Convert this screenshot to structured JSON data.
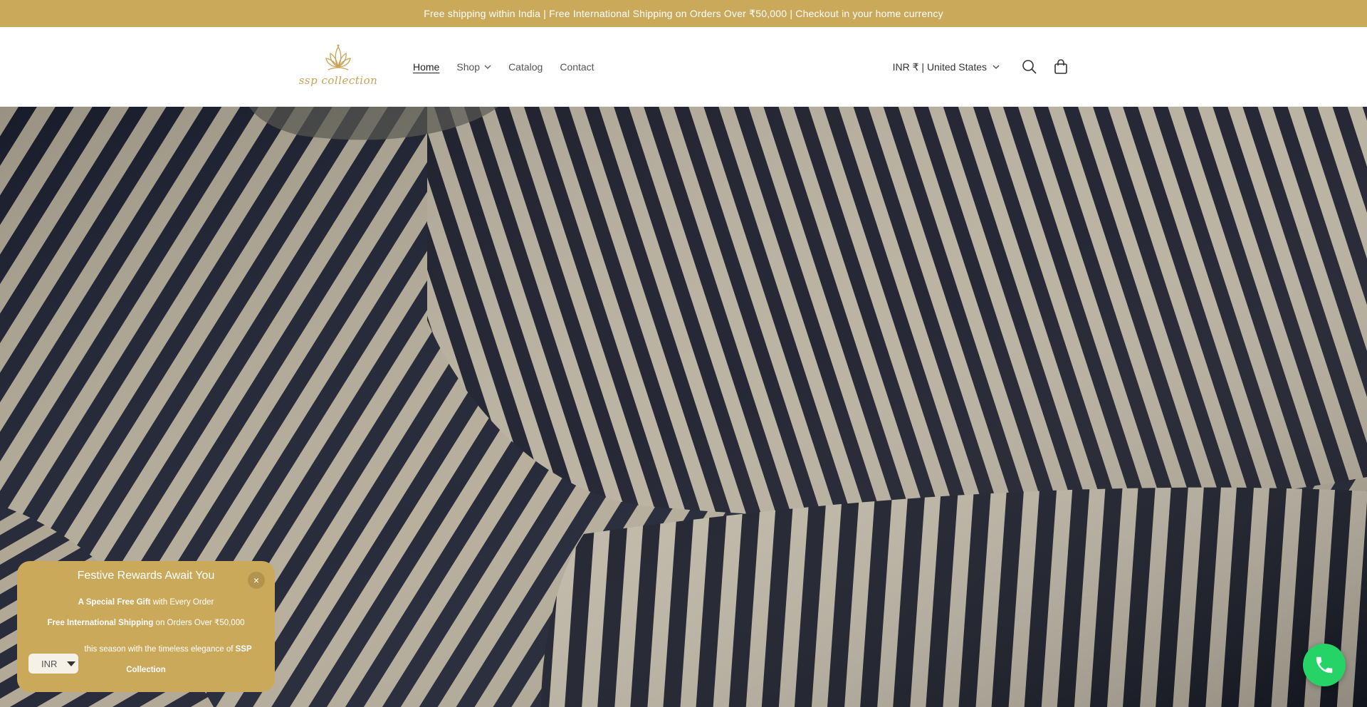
{
  "announcement": "Free shipping within India | Free International Shipping on Orders Over ₹50,000 | Checkout in your home currency",
  "logo": {
    "text": "ssp collection"
  },
  "nav": [
    {
      "label": "Home"
    },
    {
      "label": "Shop"
    },
    {
      "label": "Catalog"
    },
    {
      "label": "Contact"
    }
  ],
  "header": {
    "currency": "INR ₹ | United States"
  },
  "icons": {
    "search": "search-icon",
    "cart": "cart-icon",
    "whatsapp": "whatsapp-icon",
    "close": "close-icon"
  },
  "popup": {
    "title": "Festive Rewards Await You",
    "close": "×",
    "line1_bold": "A Special Free Gift",
    "line1_rest": " with Every Order",
    "line2_bold": "Free International Shipping",
    "line2_rest": " on Orders Over ₹50,000",
    "line3_text": "this season with the timeless elegance of ",
    "line3_bold": "SSP Collection",
    "currency_select": "INR"
  },
  "colors": {
    "accent": "#cba95b",
    "whatsapp": "#25d366"
  }
}
